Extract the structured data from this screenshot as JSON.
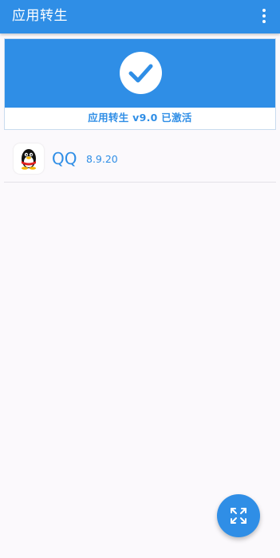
{
  "toolbar": {
    "title": "应用转生",
    "overflow_icon": "more-vert-icon",
    "background_color": "#2f8ee6"
  },
  "status_card": {
    "icon": "check-circle-icon",
    "status_text": "应用转生 v9.0 已激活"
  },
  "app_list": [
    {
      "name": "QQ",
      "version": "8.9.20",
      "icon": "qq-penguin-icon"
    }
  ],
  "fab": {
    "icon": "expand-arrows-icon"
  },
  "colors": {
    "accent": "#2f8ee6",
    "background": "#fbf9fc"
  }
}
